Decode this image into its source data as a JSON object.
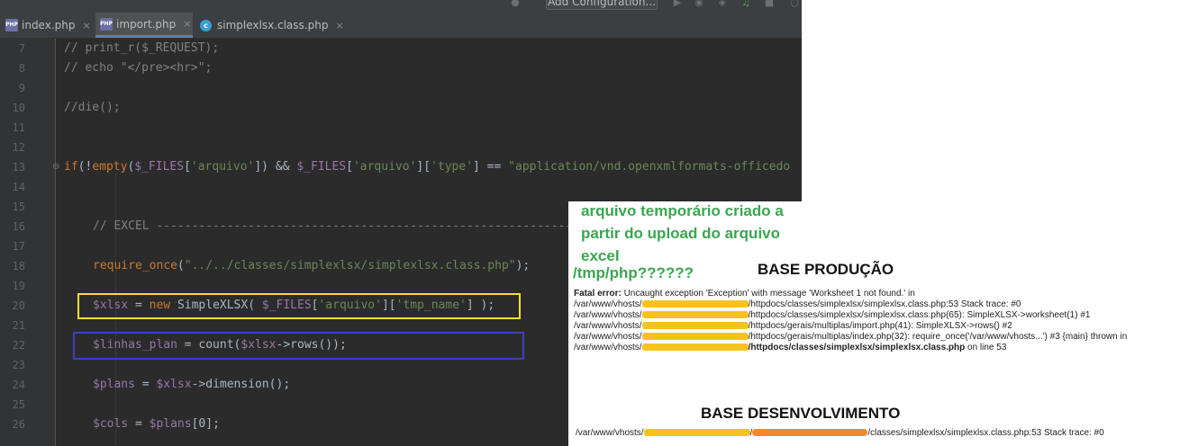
{
  "toolbar": {
    "config_button": "Add Configuration..."
  },
  "tabs": [
    {
      "label": "index.php",
      "icon": "php-file-icon",
      "active": false
    },
    {
      "label": "import.php",
      "icon": "php-file-icon",
      "active": true
    },
    {
      "label": "simplexlsx.class.php",
      "icon": "class-file-icon",
      "active": false
    }
  ],
  "php_icon_text": "PHP",
  "class_icon_text": "c",
  "close_glyph": "×",
  "line_numbers": [
    "7",
    "8",
    "9",
    "10",
    "11",
    "12",
    "13",
    "14",
    "15",
    "16",
    "17",
    "18",
    "19",
    "20",
    "21",
    "22",
    "23",
    "24",
    "25",
    "26"
  ],
  "code": {
    "l7": "// print_r($_REQUEST);",
    "l8": "// echo \"</pre><hr>\";",
    "l10": "//die();",
    "l13_a": "if",
    "l13_b": "(!",
    "l13_c": "empty",
    "l13_d": "(",
    "l13_e": "$_FILES",
    "l13_f": "[",
    "l13_g": "'arquivo'",
    "l13_h": "]) && ",
    "l13_i": "$_FILES",
    "l13_j": "[",
    "l13_k": "'arquivo'",
    "l13_l": "][",
    "l13_m": "'type'",
    "l13_n": "] == ",
    "l13_o": "\"application/vnd.openxmlformats-officedo",
    "l16": "// EXCEL -----------------------------------------------------------",
    "l18_a": "require_once",
    "l18_b": "(",
    "l18_c": "\"../../classes/simplexlsx/simplexlsx.class.php\"",
    "l18_d": ");",
    "l20_a": "$xlsx",
    "l20_b": " = ",
    "l20_c": "new ",
    "l20_d": "SimpleXLSX( ",
    "l20_e": "$_FILES",
    "l20_f": "[",
    "l20_g": "'arquivo'",
    "l20_h": "][",
    "l20_i": "'tmp_name'",
    "l20_j": "] );",
    "l22_a": "$linhas_plan",
    "l22_b": " = count(",
    "l22_c": "$xlsx",
    "l22_d": "->rows());",
    "l24_a": "$plans",
    "l24_b": " = ",
    "l24_c": "$xlsx",
    "l24_d": "->dimension();",
    "l26_a": "$cols",
    "l26_b": " = ",
    "l26_c": "$plans",
    "l26_d": "[0];"
  },
  "annotations": {
    "green_note": "arquivo temporário criado a partir do upload do arquivo excel",
    "tmp_label": "/tmp/php??????",
    "prod_title": "BASE PRODUÇÃO",
    "dev_title": "BASE DESENVOLVIMENTO",
    "error_lines": [
      {
        "prefix": "Fatal error:",
        "text": " Uncaught exception 'Exception' with message 'Worksheet 1 not found.' in"
      },
      {
        "pre": "/var/www/vhosts/",
        "post": "/httpdocs/classes/simplexlsx/simplexlsx.class.php:53 Stack trace: #0"
      },
      {
        "pre": "/var/www/vhosts/",
        "post": "/httpdocs/classes/simplexlsx/simplexlsx.class.php(65): SimpleXLSX->worksheet(1) #1"
      },
      {
        "pre": "/var/www/vhosts/",
        "post": "/httpdocs/gerais/multiplas/import.php(41): SimpleXLSX->rows() #2"
      },
      {
        "pre": "/var/www/vhosts/",
        "post": "/httpdocs/gerais/multiplas/index.php(32): require_once('/var/www/vhosts...') #3 {main} thrown in"
      },
      {
        "pre": "/var/www/vhosts/",
        "post": "/httpdocs/classes/simplexlsx/simplexlsx.class.php",
        "tail": " on line 53"
      }
    ],
    "dev_line_pre": "/var/www/vhosts/",
    "dev_line_sep": "/",
    "dev_line_post": "/classes/simplexlsx/simplexlsx.class.php:53 Stack trace: #0"
  }
}
